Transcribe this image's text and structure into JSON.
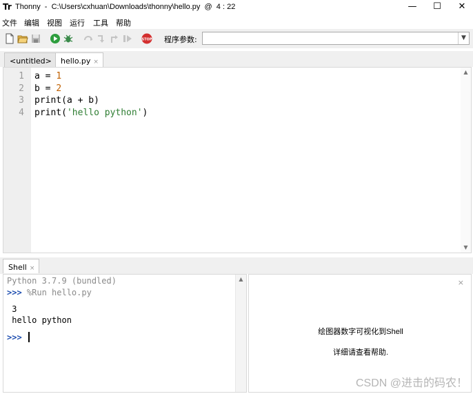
{
  "window": {
    "logo_text": "Tr",
    "title": "Thonny  -  C:\\Users\\cxhuan\\Downloads\\thonny\\hello.py  @  4 : 22",
    "minimize": "—",
    "maximize": "☐",
    "close": "✕"
  },
  "menu": [
    "文件",
    "编辑",
    "视图",
    "运行",
    "工具",
    "帮助"
  ],
  "toolbar": {
    "args_label": "程序参数:",
    "args_value": "",
    "stop_label": "STOP"
  },
  "editor_tabs": [
    {
      "label": "<untitled>",
      "close": "×"
    },
    {
      "label": "hello.py",
      "close": "×"
    }
  ],
  "editor": {
    "line_numbers": [
      "1",
      "2",
      "3",
      "4"
    ],
    "lines": [
      {
        "pre": "a = ",
        "num": "1"
      },
      {
        "pre": "b = ",
        "num": "2"
      },
      {
        "text": "print(a + b)"
      },
      {
        "pre": "print(",
        "str": "'hello python'",
        "post": ")"
      }
    ]
  },
  "shell_tab": {
    "label": "Shell",
    "close": "×"
  },
  "shell": {
    "banner": "Python 3.7.9 (bundled)",
    "prompt": ">>>",
    "run_cmd": " %Run hello.py",
    "output": [
      " 3",
      " hello python"
    ]
  },
  "plotter": {
    "close": "×",
    "line1": "绘图器数字可视化到Shell",
    "line2": "详细请查看帮助."
  },
  "watermark": "CSDN @进击的码农！",
  "colors": {
    "accent_prompt": "#1f4fb0",
    "number": "#c06000",
    "string": "#2e7d32",
    "toolbar_bg": "#f0f0f0"
  }
}
